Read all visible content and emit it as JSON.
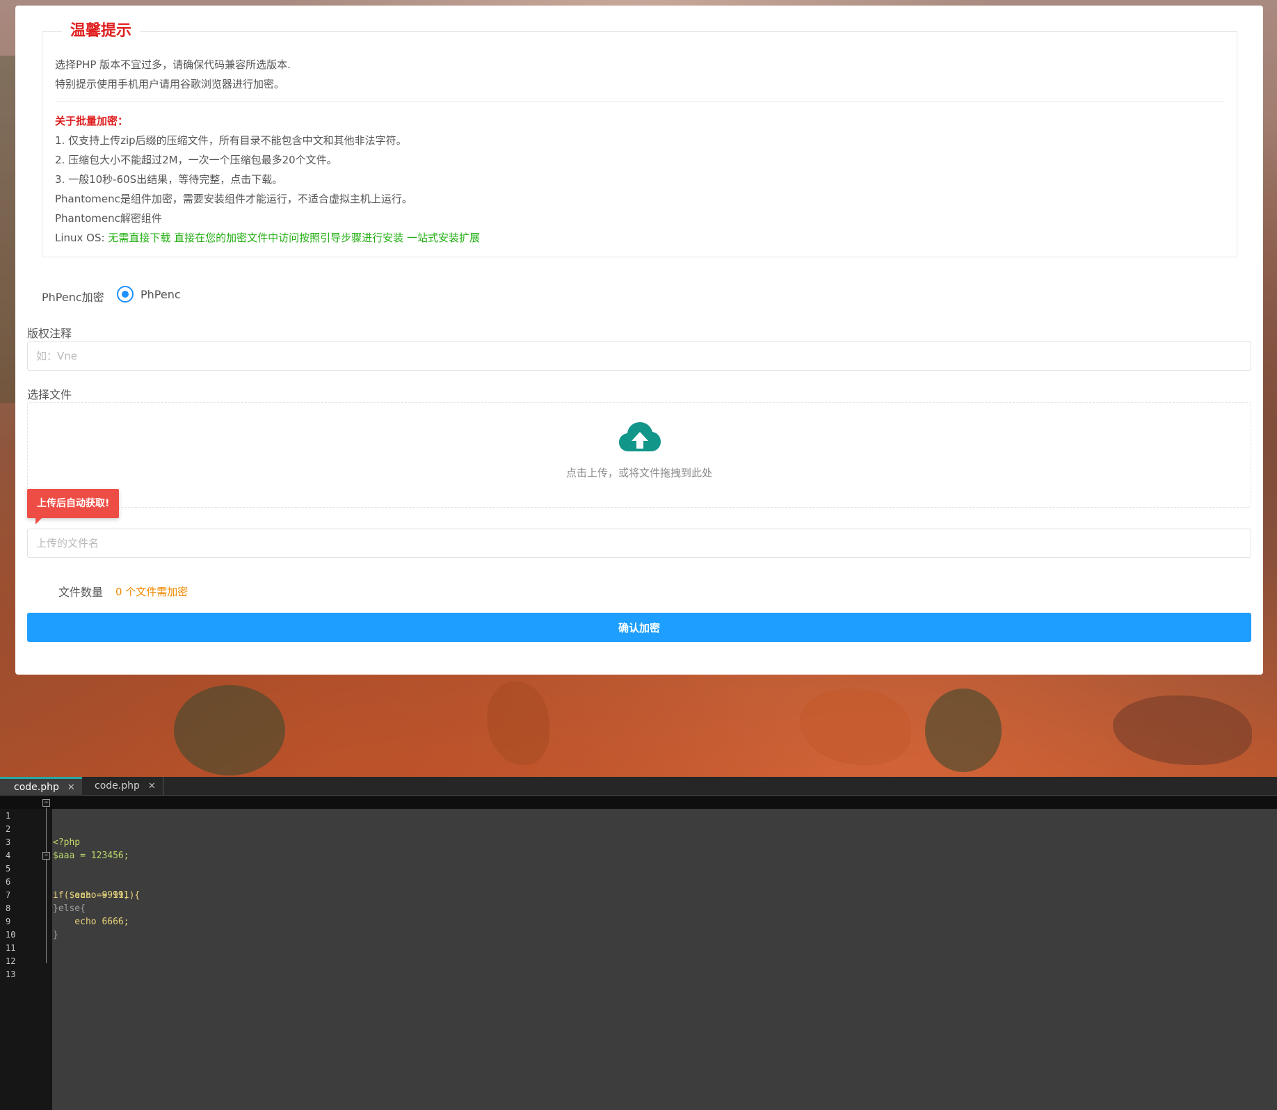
{
  "notice": {
    "title": "温馨提示",
    "line1": "选择PHP 版本不宜过多，请确保代码兼容所选版本.",
    "line2": "特别提示使用手机用户请用谷歌浏览器进行加密。",
    "batch_title": "关于批量加密：",
    "batch1": "1. 仅支持上传zip后缀的压缩文件，所有目录不能包含中文和其他非法字符。",
    "batch2": "2. 压缩包大小不能超过2M，一次一个压缩包最多20个文件。",
    "batch3": "3. 一般10秒-60S出结果，等待完整，点击下载。",
    "phantom1": "Phantomenc是组件加密，需要安装组件才能运行，不适合虚拟主机上运行。",
    "phantom2": "Phantomenc解密组件",
    "linux_label": "Linux OS: ",
    "linux_link1": "无需直接下载",
    "linux_link2": "直接在您的加密文件中访问按照引导步骤进行安装",
    "linux_link3": "一站式安装扩展"
  },
  "encrypt_type": {
    "label": "PhPenc加密",
    "option": "PhPenc",
    "selected": true
  },
  "copyright": {
    "label": "版权注释",
    "placeholder": "如：Vne",
    "value": ""
  },
  "file_select": {
    "label": "选择文件",
    "drop_text": "点击上传，或将文件拖拽到此处",
    "icon": "cloud-upload-icon"
  },
  "filename": {
    "tip": "上传后自动获取!",
    "placeholder": "上传的文件名",
    "value": ""
  },
  "file_count": {
    "label": "文件数量",
    "value": "0 个文件需加密"
  },
  "submit": {
    "label": "确认加密"
  },
  "colors": {
    "accent": "#1e9fff",
    "notice_title": "#e02020",
    "link": "#23b014",
    "count": "#f08a00",
    "tip_bg": "#ee4d45",
    "upload_icon": "#12968a"
  },
  "editor": {
    "tabs": [
      {
        "label": "code.php",
        "close": "✕"
      },
      {
        "label": "code.php",
        "close": "✕"
      }
    ],
    "lines": [
      {
        "n": "1",
        "text": "<?php"
      },
      {
        "n": "2",
        "text": ""
      },
      {
        "n": "3",
        "text": "$aaa = 123456;"
      },
      {
        "n": "4",
        "text": ""
      },
      {
        "n": "5",
        "text": "if($aaa == 111){"
      },
      {
        "n": "6",
        "text": "    echo 9999;"
      },
      {
        "n": "7",
        "text": "}else{"
      },
      {
        "n": "8",
        "text": "    echo 6666;"
      },
      {
        "n": "9",
        "text": "}"
      },
      {
        "n": "10",
        "text": ""
      },
      {
        "n": "11",
        "text": ""
      },
      {
        "n": "12",
        "text": ""
      },
      {
        "n": "13",
        "text": ""
      }
    ]
  }
}
